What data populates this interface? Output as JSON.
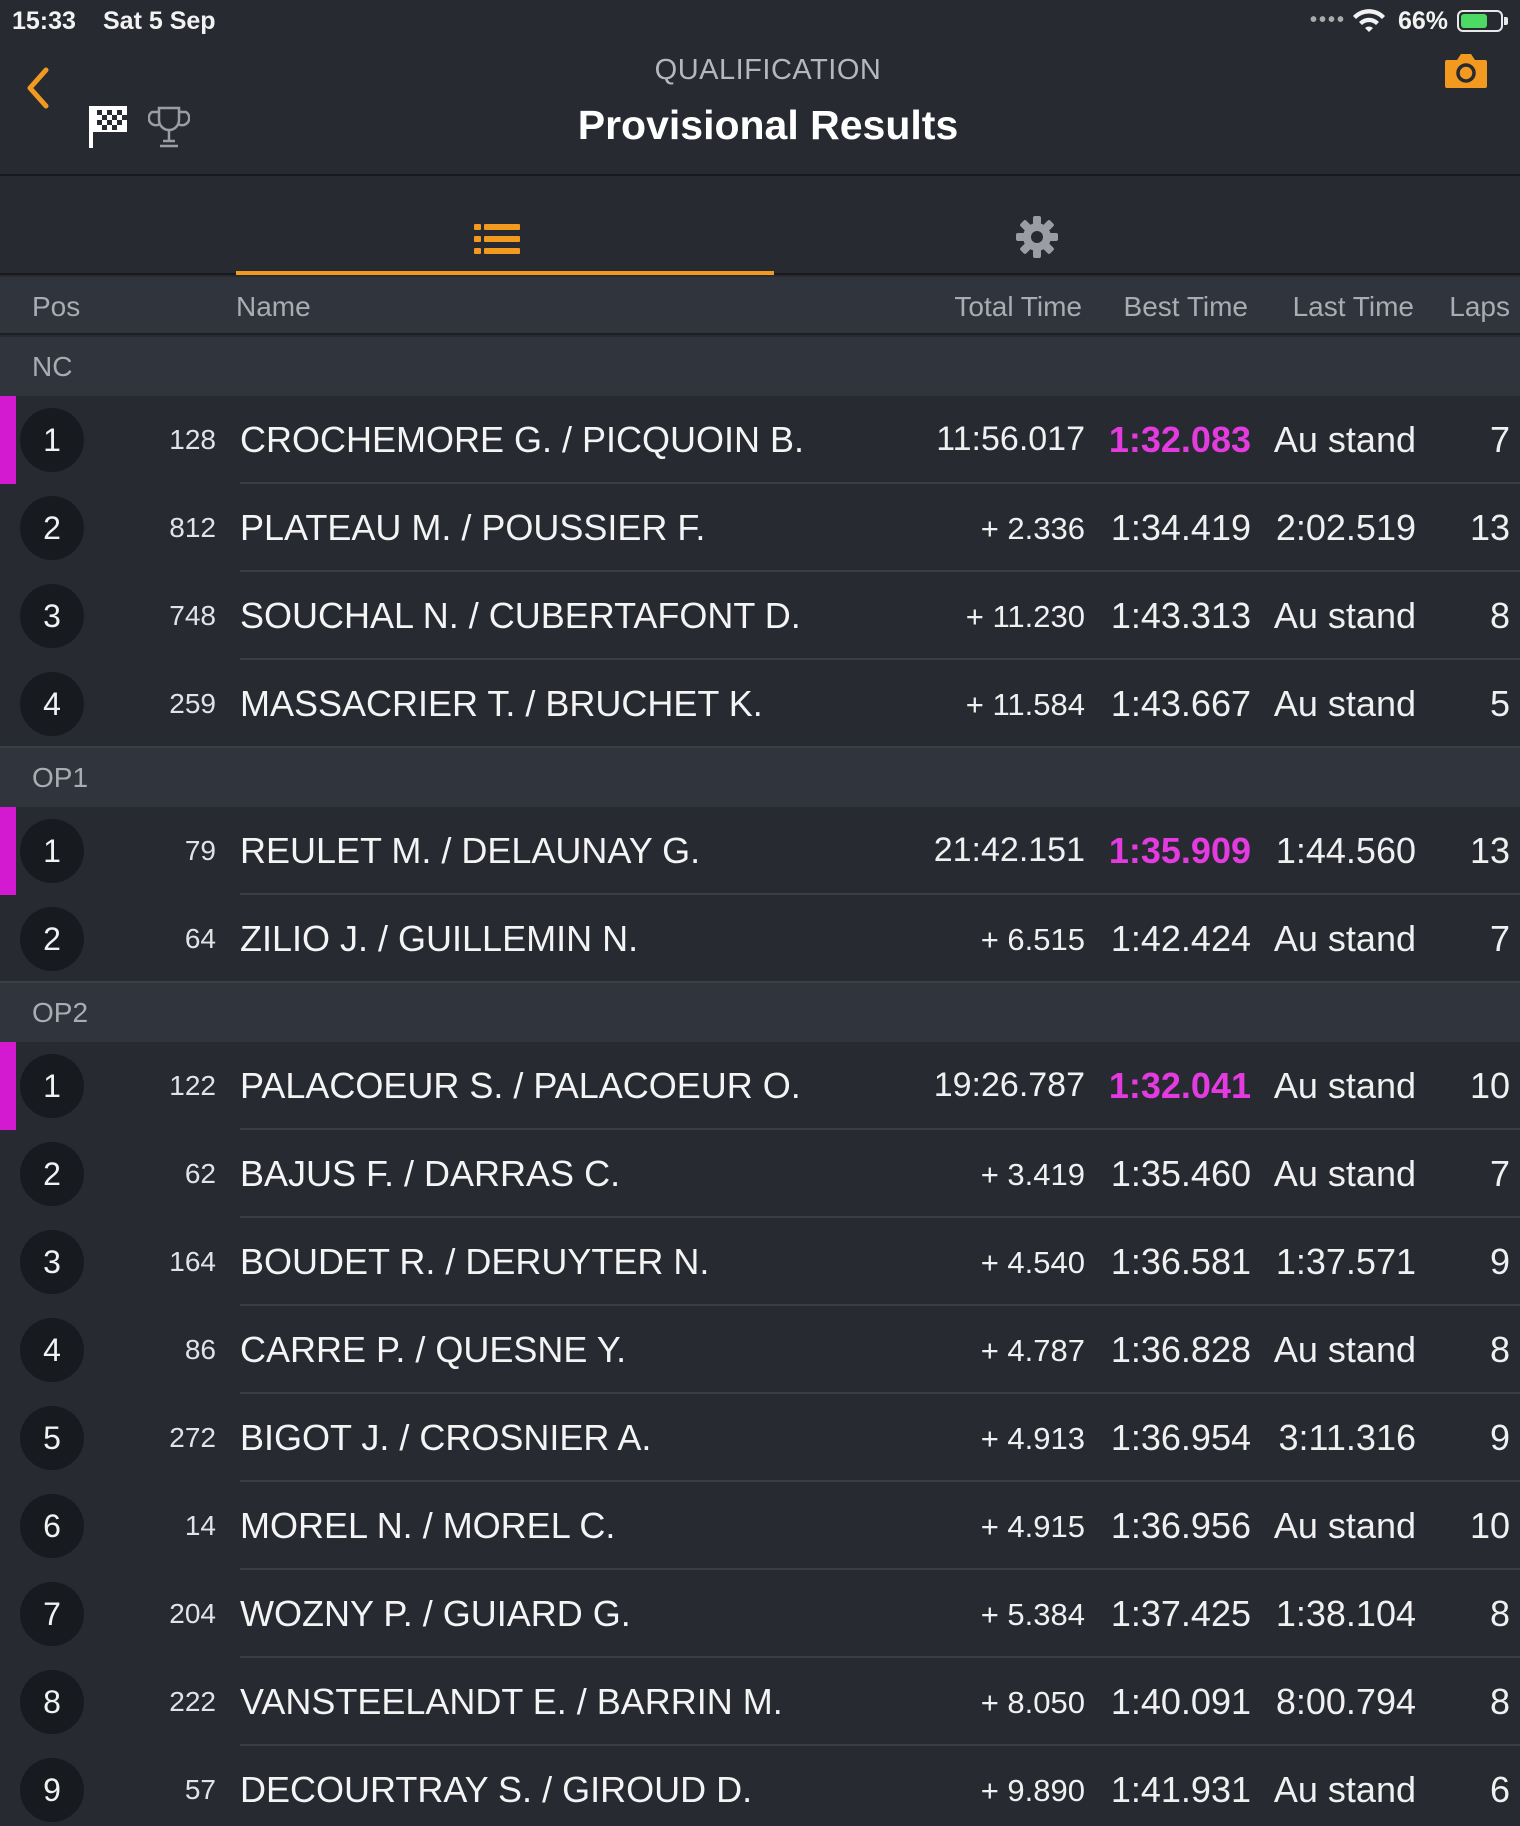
{
  "status_bar": {
    "time": "15:33",
    "date": "Sat 5 Sep",
    "battery_percent": "66%",
    "battery_level": 0.66
  },
  "header": {
    "subtitle": "QUALIFICATION",
    "title": "Provisional Results"
  },
  "columns": {
    "pos": "Pos",
    "name": "Name",
    "total": "Total Time",
    "best": "Best Time",
    "last": "Last Time",
    "laps": "Laps"
  },
  "groups": [
    {
      "label": "NC",
      "rows": [
        {
          "pos": "1",
          "num": "128",
          "name": "CROCHEMORE G. / PICQUOIN B.",
          "total": "11:56.017",
          "best": "1:32.083",
          "last": "Au stand",
          "laps": "7",
          "leader": true
        },
        {
          "pos": "2",
          "num": "812",
          "name": "PLATEAU M. / POUSSIER F.",
          "total": "+ 2.336",
          "best": "1:34.419",
          "last": "2:02.519",
          "laps": "13"
        },
        {
          "pos": "3",
          "num": "748",
          "name": "SOUCHAL N. / CUBERTAFONT D.",
          "total": "+ 11.230",
          "best": "1:43.313",
          "last": "Au stand",
          "laps": "8"
        },
        {
          "pos": "4",
          "num": "259",
          "name": "MASSACRIER T. / BRUCHET K.",
          "total": "+ 11.584",
          "best": "1:43.667",
          "last": "Au stand",
          "laps": "5"
        }
      ]
    },
    {
      "label": "OP1",
      "rows": [
        {
          "pos": "1",
          "num": "79",
          "name": "REULET M. / DELAUNAY G.",
          "total": "21:42.151",
          "best": "1:35.909",
          "last": "1:44.560",
          "laps": "13",
          "leader": true
        },
        {
          "pos": "2",
          "num": "64",
          "name": "ZILIO J. / GUILLEMIN N.",
          "total": "+ 6.515",
          "best": "1:42.424",
          "last": "Au stand",
          "laps": "7"
        }
      ]
    },
    {
      "label": "OP2",
      "rows": [
        {
          "pos": "1",
          "num": "122",
          "name": "PALACOEUR S. / PALACOEUR O.",
          "total": "19:26.787",
          "best": "1:32.041",
          "last": "Au stand",
          "laps": "10",
          "leader": true
        },
        {
          "pos": "2",
          "num": "62",
          "name": "BAJUS F. / DARRAS C.",
          "total": "+ 3.419",
          "best": "1:35.460",
          "last": "Au stand",
          "laps": "7"
        },
        {
          "pos": "3",
          "num": "164",
          "name": "BOUDET R. / DERUYTER N.",
          "total": "+ 4.540",
          "best": "1:36.581",
          "last": "1:37.571",
          "laps": "9"
        },
        {
          "pos": "4",
          "num": "86",
          "name": "CARRE P. / QUESNE Y.",
          "total": "+ 4.787",
          "best": "1:36.828",
          "last": "Au stand",
          "laps": "8"
        },
        {
          "pos": "5",
          "num": "272",
          "name": "BIGOT J. / CROSNIER A.",
          "total": "+ 4.913",
          "best": "1:36.954",
          "last": "3:11.316",
          "laps": "9"
        },
        {
          "pos": "6",
          "num": "14",
          "name": "MOREL N. / MOREL C.",
          "total": "+ 4.915",
          "best": "1:36.956",
          "last": "Au stand",
          "laps": "10"
        },
        {
          "pos": "7",
          "num": "204",
          "name": "WOZNY P. / GUIARD G.",
          "total": "+ 5.384",
          "best": "1:37.425",
          "last": "1:38.104",
          "laps": "8"
        },
        {
          "pos": "8",
          "num": "222",
          "name": "VANSTEELANDT E. / BARRIN M.",
          "total": "+ 8.050",
          "best": "1:40.091",
          "last": "8:00.794",
          "laps": "8"
        },
        {
          "pos": "9",
          "num": "57",
          "name": "DECOURTRAY S. / GIROUD D.",
          "total": "+ 9.890",
          "best": "1:41.931",
          "last": "Au stand",
          "laps": "6"
        }
      ]
    }
  ],
  "colors": {
    "accent_orange": "#f19a1f",
    "fastest_magenta": "#e43be0",
    "background": "#272a31",
    "battery_green": "#4cd964"
  },
  "icons": {
    "back": "chevron-left-icon",
    "flag": "checkered-flag-icon",
    "trophy": "trophy-icon",
    "camera": "camera-icon",
    "list": "list-icon",
    "settings": "gear-icon"
  }
}
